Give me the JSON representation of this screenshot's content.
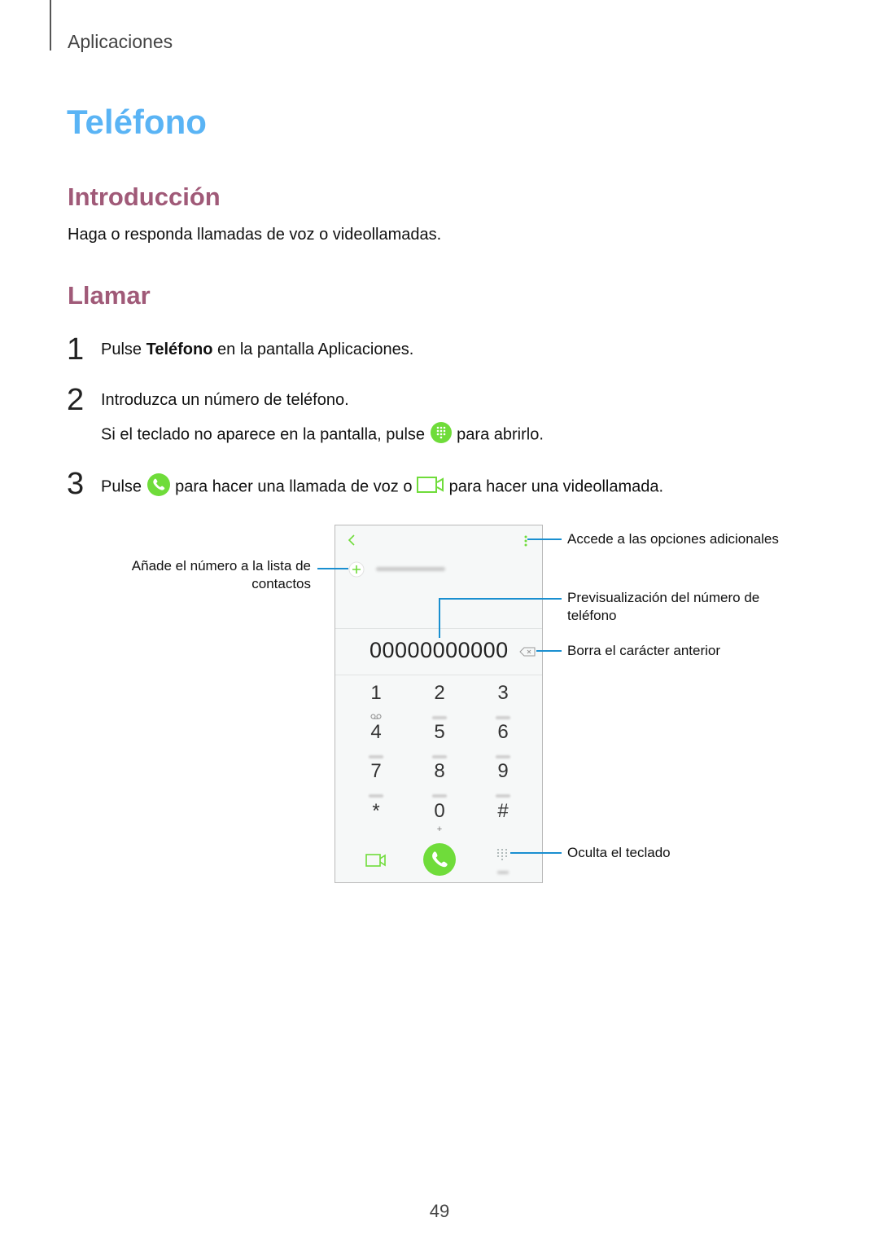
{
  "header": {
    "chapter": "Aplicaciones"
  },
  "title": "Teléfono",
  "sections": {
    "intro": {
      "heading": "Introducción",
      "text": "Haga o responda llamadas de voz o videollamadas."
    },
    "call": {
      "heading": "Llamar"
    }
  },
  "steps": [
    {
      "num": "1",
      "pre": "Pulse ",
      "bold": "Teléfono",
      "post": " en la pantalla Aplicaciones."
    },
    {
      "num": "2",
      "text": "Introduzca un número de teléfono.",
      "sub_pre": "Si el teclado no aparece en la pantalla, pulse ",
      "sub_post": " para abrirlo.",
      "sub_icon": "keypad-icon"
    },
    {
      "num": "3",
      "pre": "Pulse ",
      "mid": " para hacer una llamada de voz o ",
      "post": " para hacer una videollamada.",
      "icons": [
        "phone-call-icon",
        "video-call-icon"
      ]
    }
  ],
  "phone": {
    "number": "00000000000",
    "keys": [
      {
        "digit": "1"
      },
      {
        "digit": "2"
      },
      {
        "digit": "3"
      },
      {
        "digit": "4"
      },
      {
        "digit": "5"
      },
      {
        "digit": "6"
      },
      {
        "digit": "7"
      },
      {
        "digit": "8"
      },
      {
        "digit": "9"
      },
      {
        "digit": "*"
      },
      {
        "digit": "0",
        "sub": "+"
      },
      {
        "digit": "#"
      }
    ],
    "accent_color": "#6fdc3a"
  },
  "callouts": {
    "more_options": "Accede a las opciones adicionales",
    "add_contact_line1": "Añade el número a la lista de",
    "add_contact_line2": "contactos",
    "preview_line1": "Previsualización del número de",
    "preview_line2": "teléfono",
    "backspace": "Borra el carácter anterior",
    "hide_keypad": "Oculta el teclado"
  },
  "page_number": "49"
}
